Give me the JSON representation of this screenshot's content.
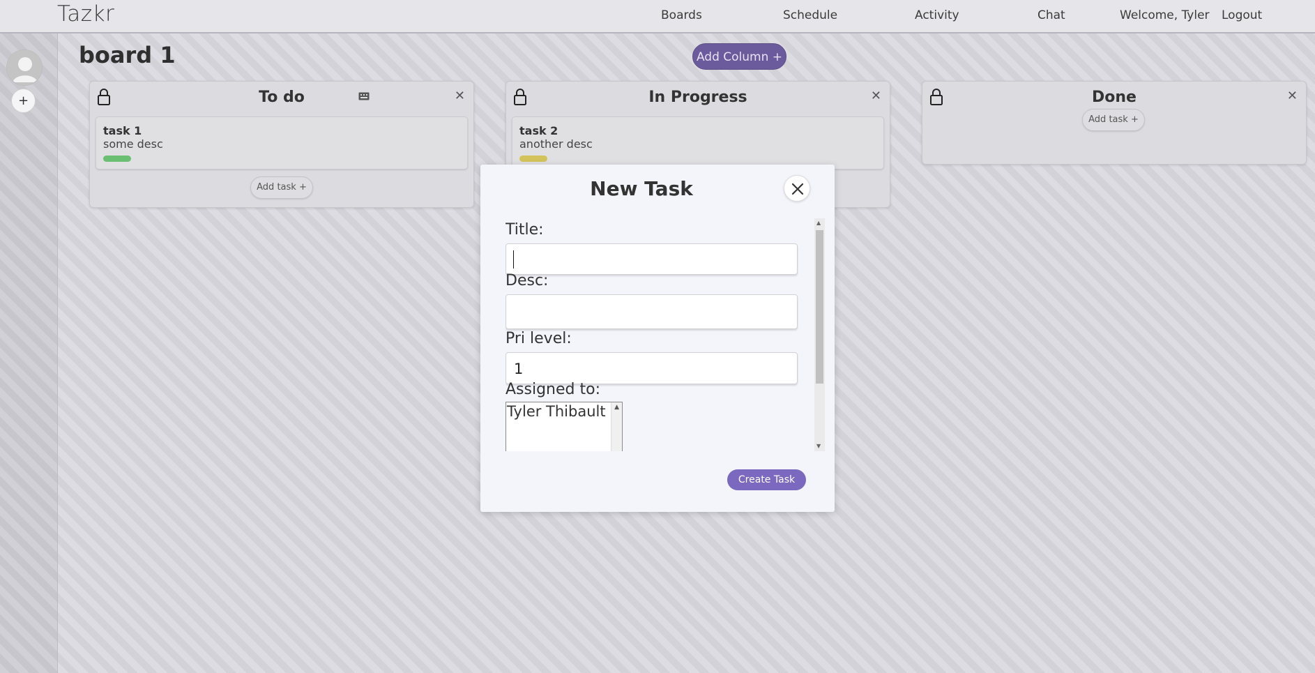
{
  "nav": {
    "brand": "Tazkr",
    "links": [
      "Boards",
      "Schedule",
      "Activity",
      "Chat",
      "Welcome, Tyler",
      "Logout"
    ]
  },
  "sidebar": {
    "add_label": "+"
  },
  "board": {
    "title": "board 1",
    "add_column_label": "Add Column +",
    "columns": [
      {
        "title": "To do",
        "tasks": [
          {
            "title": "task 1",
            "desc": "some desc",
            "priority_color": "#6bbf73"
          }
        ],
        "add_task_label": "Add task +"
      },
      {
        "title": "In Progress",
        "tasks": [
          {
            "title": "task 2",
            "desc": "another desc",
            "priority_color": "#d3c35a"
          }
        ]
      },
      {
        "title": "Done",
        "tasks": [],
        "add_task_label": "Add task +"
      }
    ]
  },
  "modal": {
    "title": "New Task",
    "fields": {
      "title_label": "Title:",
      "title_value": "",
      "desc_label": "Desc:",
      "desc_value": "",
      "pri_label": "Pri level:",
      "pri_value": "1",
      "assigned_label": "Assigned to:",
      "assigned_options": [
        "Tyler Thibault"
      ]
    },
    "submit_label": "Create Task"
  },
  "colors": {
    "accent": "#7b68bf",
    "add_column_bg": "#6c5b9c"
  },
  "icons": [
    "lock-icon",
    "close-icon",
    "edit-icon",
    "avatar-icon",
    "plus-icon"
  ]
}
